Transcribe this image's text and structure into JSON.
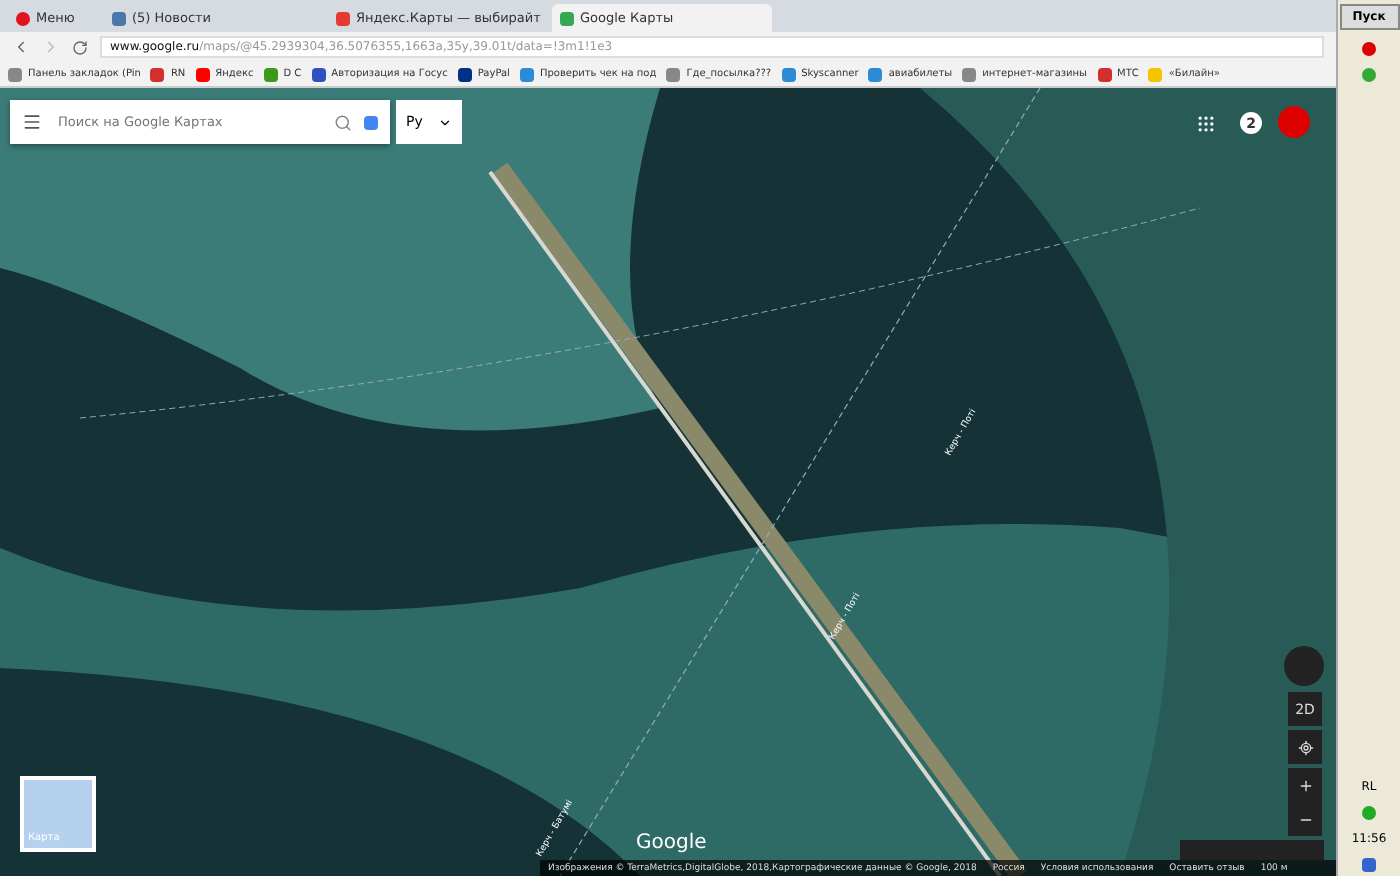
{
  "tabs": [
    {
      "label": "Меню",
      "kind": "menu",
      "selected": false
    },
    {
      "label": "(5) Новости",
      "kind": "vk",
      "selected": false
    },
    {
      "label": "Яндекс.Карты — выбирайт",
      "kind": "pin",
      "selected": false
    },
    {
      "label": "Google Карты",
      "kind": "gmaps",
      "selected": true
    }
  ],
  "address": {
    "host": "www.google.ru",
    "path": "/maps/@45.2939304,36.5076355,1663a,35y,39.01t/data=!3m1!1e3"
  },
  "bookmarks": [
    {
      "label": "Панель закладок (Pin",
      "kind": "folder"
    },
    {
      "label": "RN",
      "kind": "red"
    },
    {
      "label": "Яндекс",
      "kind": "ya"
    },
    {
      "label": "D C",
      "kind": "green"
    },
    {
      "label": "Авторизация на Госус",
      "kind": "flag"
    },
    {
      "label": "PayPal",
      "kind": "paypal"
    },
    {
      "label": "Проверить чек на под",
      "kind": "blue"
    },
    {
      "label": "Где_посылка???",
      "kind": "folder"
    },
    {
      "label": "Skyscanner",
      "kind": "blue"
    },
    {
      "label": "авиабилеты",
      "kind": "blue"
    },
    {
      "label": "интернет-магазины",
      "kind": "folder"
    },
    {
      "label": "МТС",
      "kind": "red"
    },
    {
      "label": "«Билайн»",
      "kind": "bee"
    }
  ],
  "map": {
    "search": {
      "placeholder": "Поиск на Google Картах"
    },
    "language": "Ру",
    "notifications": "2",
    "labels": [
      "Керч - Поті",
      "Керч - Поті",
      "Керч - Батумі"
    ],
    "thumbnail": "Карта",
    "view_mode": "2D",
    "logo": "Google",
    "footer": [
      "Изображения © TerraMetrics,DigitalGlobe, 2018,Картографические данные © Google, 2018",
      "Россия",
      "Условия использования",
      "Оставить отзыв"
    ],
    "scale": "100 м"
  },
  "taskbar": {
    "start": "Пуск",
    "lang": "RL",
    "time": "11:56"
  }
}
